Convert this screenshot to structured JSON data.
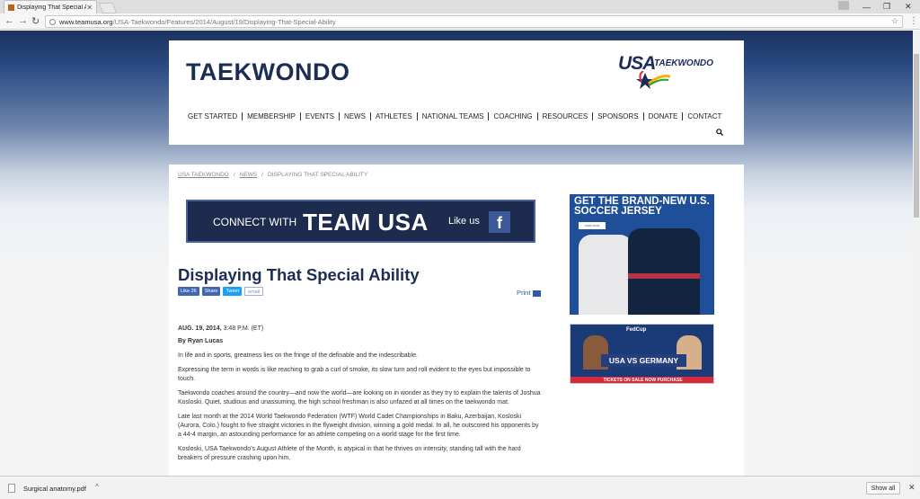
{
  "browser": {
    "tab_title": "Displaying That Special A",
    "url_host": "www.teamusa.org",
    "url_path": "/USA-Taekwondo/Features/2014/August/19/Displaying-That-Special-Ability"
  },
  "header": {
    "site_title": "TAEKWONDO",
    "logo_usa": "USA",
    "logo_tkd": "TAEKWONDO",
    "nav": [
      "GET STARTED",
      "MEMBERSHIP",
      "EVENTS",
      "NEWS",
      "ATHLETES",
      "NATIONAL TEAMS",
      "COACHING",
      "RESOURCES",
      "SPONSORS",
      "DONATE",
      "CONTACT"
    ]
  },
  "breadcrumb": {
    "home": "USA TAEKWONDO",
    "section": "NEWS",
    "current": "DISPLAYING THAT SPECIAL ABILITY"
  },
  "banner": {
    "connect": "CONNECT WITH",
    "team": "TEAM USA",
    "like": "Like us",
    "fb": "f"
  },
  "article": {
    "title": "Displaying That Special Ability",
    "like": "Like 26",
    "share": "Share",
    "tweet": "Tweet",
    "email": "email",
    "print": "Print",
    "date": "AUG. 19, 2014,",
    "time": "3:48 P.M. (ET)",
    "byline": "By Ryan Lucas",
    "paragraphs": [
      "In life and in sports, greatness lies on the fringe of the definable and the indescribable.",
      "Expressing the term in words is like reaching to grab a curl of smoke, its slow turn and roll evident to the eyes but impossible to touch.",
      "Taekwondo coaches around the country—and now the world—are looking on in wonder as they try to explain the talents of Joshua Kosloski. Quiet, studious and unassuming, the high school freshman is also unfazed at all times on the taekwondo mat.",
      "Late last month at the 2014 World Taekwondo Federation (WTF) World Cadet Championships in Baku, Azerbaijan, Kosloski (Aurora, Colo.) fought to five straight victories in the flyweight division, winning a gold medal. In all, he outscored his opponents by a 44-4 margin, an astounding performance for an athlete competing on a world stage for the first time.",
      "Kosloski, USA Taekwondo's August Athlete of the Month, is atypical in that he thrives on intensity, standing tall with the hard breakers of pressure crashing upon him."
    ]
  },
  "ads": {
    "soccer_headline": "GET THE BRAND-NEW U.S. SOCCER JERSEY",
    "soccer_btn": "SHOP NOW",
    "fedcup": "FedCup",
    "fedcup_match": "USA VS GERMANY",
    "fedcup_tickets": "TICKETS ON SALE NOW  PURCHASE"
  },
  "downloads": {
    "file": "Surgical anatomy.pdf",
    "show_all": "Show all"
  }
}
